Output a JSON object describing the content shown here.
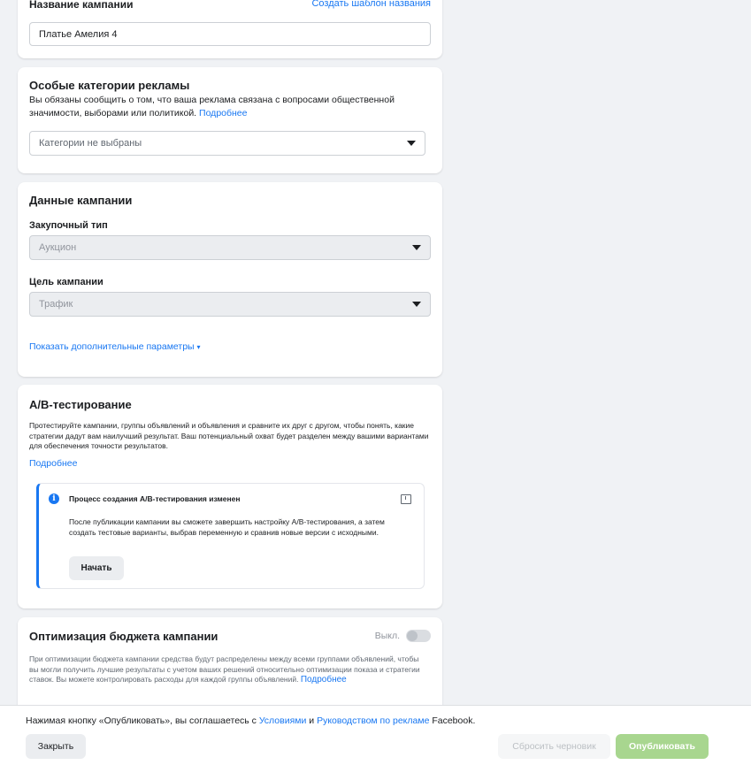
{
  "campaign_name": {
    "label": "Название кампании",
    "template_link": "Создать шаблон названия",
    "value": "Платье Амелия 4"
  },
  "special_categories": {
    "title": "Особые категории рекламы",
    "description": "Вы обязаны сообщить о том, что ваша реклама связана с вопросами общественной значимости, выборами или политикой.",
    "more_link": "Подробнее",
    "select_value": "Категории не выбраны"
  },
  "campaign_data": {
    "title": "Данные кампании",
    "buying_type_label": "Закупочный тип",
    "buying_type_value": "Аукцион",
    "objective_label": "Цель кампании",
    "objective_value": "Трафик",
    "more_params_link": "Показать дополнительные параметры"
  },
  "ab_test": {
    "title": "A/B-тестирование",
    "description": "Протестируйте кампании, группы объявлений и объявления и сравните их друг с другом, чтобы понять, какие стратегии дадут вам наилучший результат. Ваш потенциальный охват будет разделен между вашими вариантами для обеспечения точности результатов.",
    "more_link": "Подробнее",
    "notice_title": "Процесс создания A/B-тестирования изменен",
    "notice_text": "После публикации кампании вы сможете завершить настройку A/B-тестирования, а затем создать тестовые варианты, выбрав переменную и сравнив новые версии с исходными.",
    "start_button": "Начать"
  },
  "budget_optimization": {
    "title": "Оптимизация бюджета кампании",
    "toggle_label": "Выкл.",
    "toggle_on": false,
    "description": "При оптимизации бюджета кампании средства будут распределены между всеми группами объявлений, чтобы вы могли получить лучшие результаты с учетом ваших решений относительно оптимизации показа и стратегии ставок. Вы можете контролировать расходы для каждой группы объявлений.",
    "more_link": "Подробнее"
  },
  "footer": {
    "terms_prefix": "Нажимая кнопку «Опубликовать», вы соглашаетесь с ",
    "terms_link": "Условиями",
    "terms_and": " и ",
    "guidelines_link": "Руководством по рекламе",
    "terms_suffix": " Facebook.",
    "close_button": "Закрыть",
    "reset_button": "Сбросить черновик",
    "publish_button": "Опубликовать"
  },
  "colors": {
    "accent": "#1877f2",
    "publish_disabled": "#a8d68f",
    "page_bg": "#f0f2f5"
  }
}
